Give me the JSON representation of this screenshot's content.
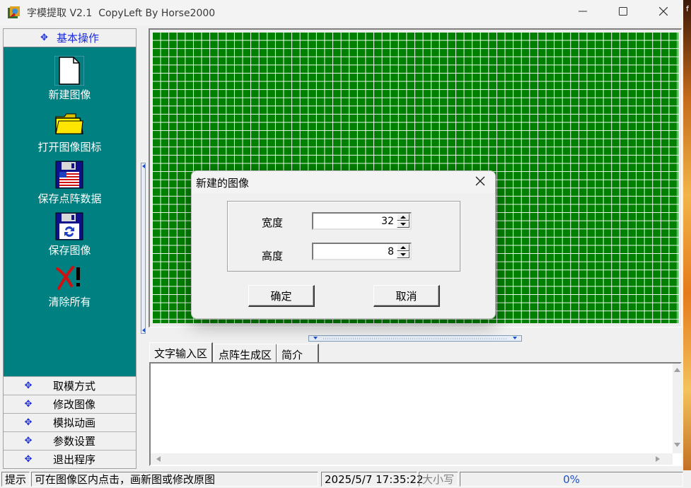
{
  "window": {
    "title": "字模提取 V2.1  CopyLeft By Horse2000",
    "minimize_icon": "minimize-icon",
    "maximize_icon": "maximize-icon",
    "close_icon": "close-icon"
  },
  "backdrop_text": "f",
  "sidebar": {
    "header": "基本操作",
    "tools": [
      {
        "label": "新建图像",
        "icon": "new-document-icon"
      },
      {
        "label": "打开图像图标",
        "icon": "folder-icon"
      },
      {
        "label": "保存点阵数据",
        "icon": "floppy-flag-icon"
      },
      {
        "label": "保存图像",
        "icon": "floppy-save-icon"
      },
      {
        "label": "清除所有",
        "icon": "clear-x-icon"
      }
    ],
    "categories": [
      "取模方式",
      "修改图像",
      "模拟动画",
      "参数设置",
      "退出程序"
    ]
  },
  "tabs": [
    "文字输入区",
    "点阵生成区",
    "简介"
  ],
  "text_area": {
    "value": ""
  },
  "statusbar": {
    "hint_label": "提示",
    "hint_text": "可在图像区内点击，画新图或修改原图",
    "datetime": "2025/5/7 17:35:22",
    "caps": "大小写",
    "progress": "0%"
  },
  "dialog": {
    "title": "新建的图像",
    "width_label": "宽度",
    "width_value": "32",
    "height_label": "高度",
    "height_value": "8",
    "ok": "确定",
    "cancel": "取消"
  },
  "colors": {
    "sidebar_panel": "#008080",
    "grid_bg": "#008000",
    "accent_blue": "#1b2cd6"
  }
}
